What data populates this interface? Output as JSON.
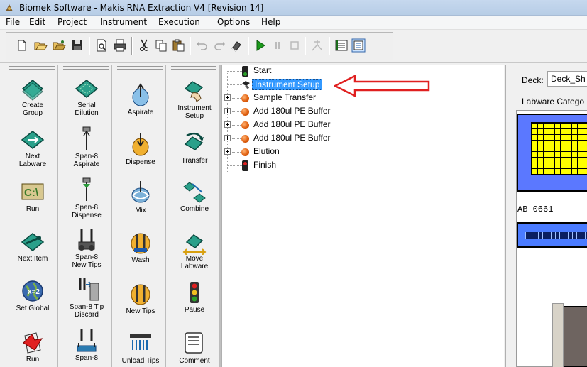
{
  "window": {
    "title": "Biomek Software - Makis RNA Extraction V4 [Revision 14]"
  },
  "menu": {
    "items": [
      "File",
      "Edit",
      "Project",
      "Instrument",
      "Execution",
      "Options",
      "Help"
    ]
  },
  "toolbar": {
    "buttons": [
      "new-icon",
      "open-icon",
      "open-project-icon",
      "save-icon",
      "print-preview-icon",
      "print-icon",
      "cut-icon",
      "copy-icon",
      "paste-icon",
      "undo-icon",
      "redo-icon",
      "eraser-icon",
      "run-icon",
      "pause-icon",
      "stop-icon",
      "step-icon",
      "deck-view-icon",
      "step-view-icon"
    ]
  },
  "palette": {
    "columns": [
      [
        {
          "label": "Create\nGroup",
          "icon": "create-group-icon"
        },
        {
          "label": "Next\nLabware",
          "icon": "next-labware-icon"
        },
        {
          "label": "Run",
          "icon": "run-script-icon"
        },
        {
          "label": "Next Item",
          "icon": "next-item-icon"
        },
        {
          "label": "Set Global",
          "icon": "set-global-icon"
        },
        {
          "label": "Run",
          "icon": "run-method-icon"
        }
      ],
      [
        {
          "label": "Serial\nDilution",
          "icon": "serial-dilution-icon"
        },
        {
          "label": "Span-8\nAspirate",
          "icon": "span8-aspirate-icon"
        },
        {
          "label": "Span-8\nDispense",
          "icon": "span8-dispense-icon"
        },
        {
          "label": "Span-8\nNew Tips",
          "icon": "span8-new-tips-icon"
        },
        {
          "label": "Span-8 Tip\nDiscard",
          "icon": "span8-tip-discard-icon"
        },
        {
          "label": "Span-8",
          "icon": "span8-icon"
        }
      ],
      [
        {
          "label": "Aspirate",
          "icon": "aspirate-icon"
        },
        {
          "label": "Dispense",
          "icon": "dispense-icon"
        },
        {
          "label": "Mix",
          "icon": "mix-icon"
        },
        {
          "label": "Wash",
          "icon": "wash-icon"
        },
        {
          "label": "New Tips",
          "icon": "new-tips-icon"
        },
        {
          "label": "Unload Tips",
          "icon": "unload-tips-icon"
        }
      ],
      [
        {
          "label": "Instrument\nSetup",
          "icon": "instrument-setup-icon"
        },
        {
          "label": "Transfer",
          "icon": "transfer-icon"
        },
        {
          "label": "Combine",
          "icon": "combine-icon"
        },
        {
          "label": "Move\nLabware",
          "icon": "move-labware-icon"
        },
        {
          "label": "Pause",
          "icon": "pause-light-icon"
        },
        {
          "label": "Comment",
          "icon": "comment-icon"
        }
      ]
    ]
  },
  "tree": {
    "start": "Start",
    "instrument_setup": "Instrument Setup",
    "sample_transfer": "Sample Transfer",
    "buffer1": "Add 180ul PE Buffer",
    "buffer2": "Add 180ul PE Buffer",
    "buffer3": "Add 180ul PE Buffer",
    "elution": "Elution",
    "finish": "Finish"
  },
  "deck": {
    "label": "Deck:",
    "value": "Deck_Sh",
    "labware_category": "Labware Catego",
    "plate_label": "AB 0661"
  },
  "colors": {
    "annotation_arrow": "#e02020",
    "selection": "#3399ff"
  }
}
